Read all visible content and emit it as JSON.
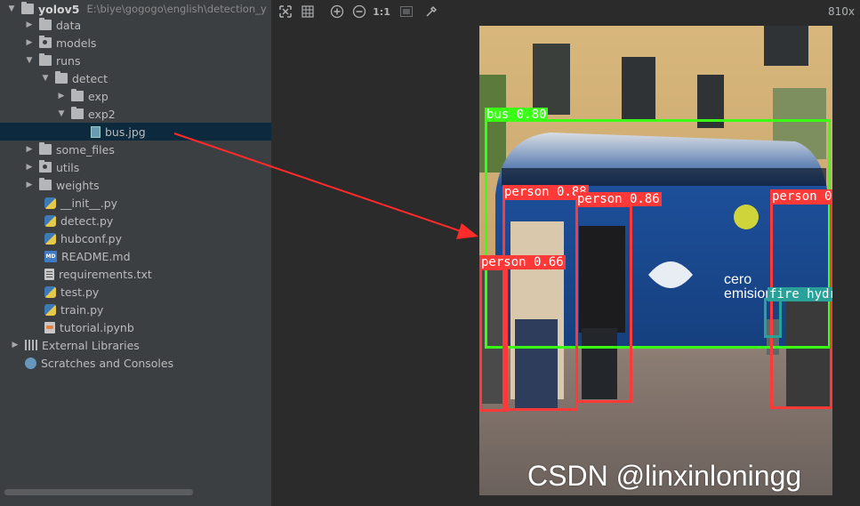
{
  "project": {
    "name": "yolov5",
    "path": "E:\\biye\\gogogo\\english\\detection_y"
  },
  "tree": {
    "data": "data",
    "models": "models",
    "runs": "runs",
    "detect": "detect",
    "exp": "exp",
    "exp2": "exp2",
    "bus_jpg": "bus.jpg",
    "some_files": "some_files",
    "utils": "utils",
    "weights": "weights",
    "init_py": "__init__.py",
    "detect_py": "detect.py",
    "hubconf_py": "hubconf.py",
    "readme_md": "README.md",
    "requirements_txt": "requirements.txt",
    "test_py": "test.py",
    "train_py": "train.py",
    "tutorial_ipynb": "tutorial.ipynb",
    "external_libraries": "External Libraries",
    "scratches": "Scratches and Consoles"
  },
  "viewer": {
    "one_to_one": "1:1",
    "size": "810x"
  },
  "detections": {
    "bus": "bus 0.80",
    "person1": "person 0.88",
    "person2": "person 0.86",
    "person3": "person 0",
    "person4": "person 0.66",
    "hydrant": "fire hydra"
  },
  "watermark": "CSDN @linxinloningg",
  "colors": {
    "sidebar_bg": "#3c3f41",
    "editor_bg": "#2b2b2b",
    "selected_row": "#0d293e",
    "person_box": "#ff3838",
    "bus_box": "#39ff14",
    "hydrant_box": "#2aa198",
    "arrow": "#ff2a2a"
  }
}
